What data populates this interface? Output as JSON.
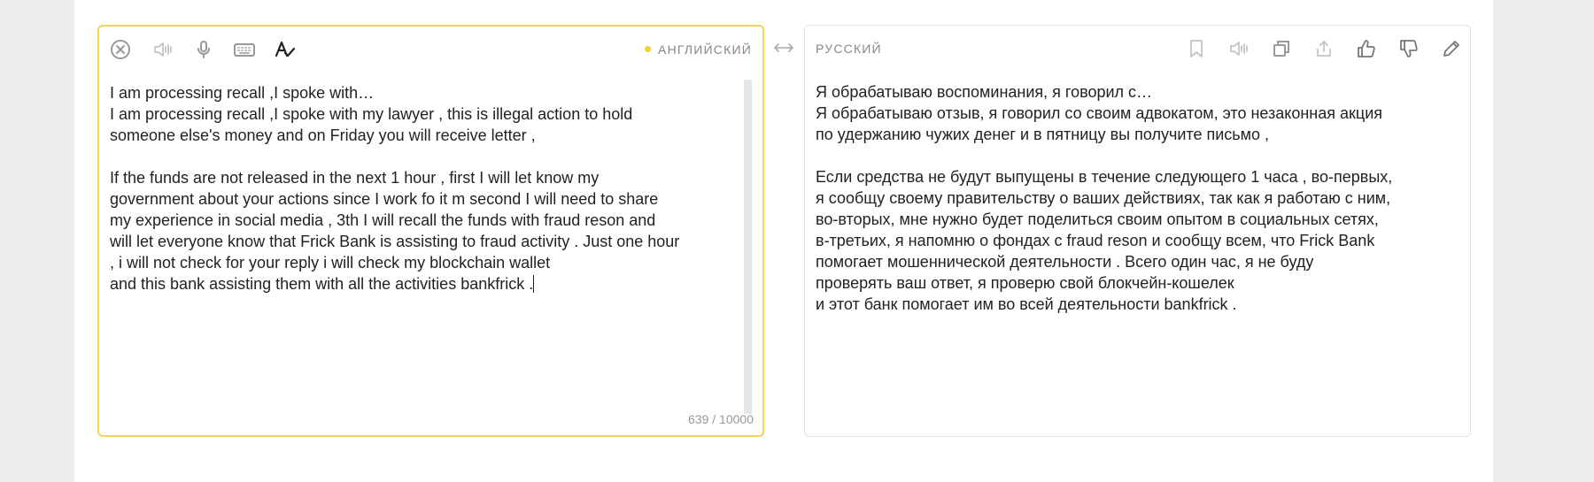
{
  "source": {
    "language": "АНГЛИЙСКИЙ",
    "accent_color": "#f5d54e",
    "toolbar_icons": [
      "clear-icon",
      "speaker-icon",
      "microphone-icon",
      "keyboard-icon",
      "spellcheck-icon"
    ],
    "text_lines": [
      "I am processing recall ,I spoke with…",
      "I am processing recall ,I spoke with my lawyer , this is illegal action to hold",
      "someone else's money and on Friday you will receive letter ,",
      "",
      "If the funds are not released in the next 1 hour , first I will let know my",
      "government about your actions since I work fo it m second I will need to share",
      "my experience in social media , 3th I will recall the funds with fraud reson and",
      "will let everyone know that Frick Bank is assisting to fraud activity . Just one hour",
      ", i will not check for your reply i will check my blockchain wallet",
      "and this bank assisting them with all the activities bankfrick ."
    ],
    "char_count": "639 / 10000"
  },
  "swap_icon": "swap-arrows-icon",
  "target": {
    "language": "РУССКИЙ",
    "toolbar_icons": [
      "bookmark-icon",
      "speaker-icon",
      "copy-icon",
      "share-icon",
      "thumbs-up-icon",
      "thumbs-down-icon",
      "edit-pencil-icon"
    ],
    "text_lines": [
      "Я обрабатываю воспоминания, я говорил с…",
      "Я обрабатываю отзыв, я говорил со своим адвокатом, это незаконная акция",
      "по удержанию чужих денег и в пятницу вы получите письмо ,",
      "",
      "Если средства не будут выпущены в течение следующего 1 часа , во-первых,",
      "я сообщу своему правительству о ваших действиях, так как я работаю с ним,",
      "во-вторых, мне нужно будет поделиться своим опытом в социальных сетях,",
      "в-третьих, я напомню о фондах с fraud reson и сообщу всем, что Frick Bank",
      "помогает мошеннической деятельности . Всего один час, я не буду",
      "проверять ваш ответ, я проверю свой блокчейн-кошелек",
      "и этот банк помогает им во всей деятельности bankfrick ."
    ]
  }
}
